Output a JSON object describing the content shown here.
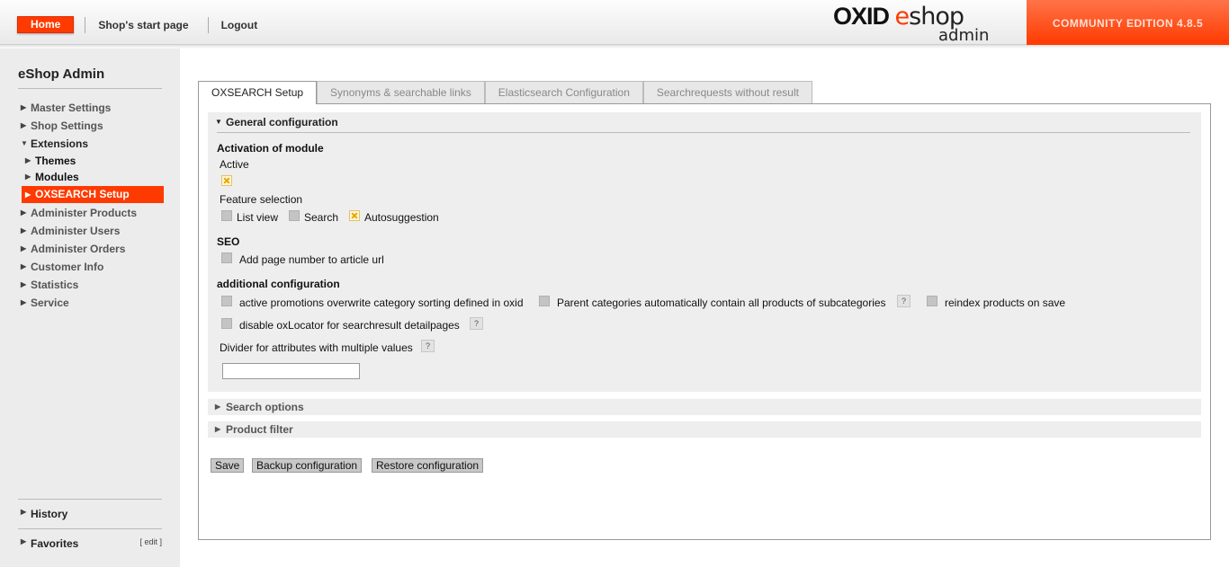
{
  "header": {
    "home_label": "Home",
    "start_page_label": "Shop's start page",
    "logout_label": "Logout",
    "logo_oxid": "OXID",
    "logo_e": "e",
    "logo_shop": "shop",
    "logo_admin": "admin",
    "edition": "COMMUNITY EDITION 4.8.5",
    "accent_color": "#ff3a00"
  },
  "sidebar": {
    "title": "eShop Admin",
    "items": [
      {
        "label": "Master Settings",
        "state": "collapsed"
      },
      {
        "label": "Shop Settings",
        "state": "collapsed"
      },
      {
        "label": "Extensions",
        "state": "open"
      },
      {
        "label": "Themes",
        "state": "sub"
      },
      {
        "label": "Modules",
        "state": "sub"
      },
      {
        "label": "OXSEARCH Setup",
        "state": "active"
      },
      {
        "label": "Administer Products",
        "state": "collapsed"
      },
      {
        "label": "Administer Users",
        "state": "collapsed"
      },
      {
        "label": "Administer Orders",
        "state": "collapsed"
      },
      {
        "label": "Customer Info",
        "state": "collapsed"
      },
      {
        "label": "Statistics",
        "state": "collapsed"
      },
      {
        "label": "Service",
        "state": "collapsed"
      }
    ],
    "history_label": "History",
    "favorites_label": "Favorites",
    "edit_label": "[ edit ]"
  },
  "tabs": [
    {
      "label": "OXSEARCH Setup",
      "active": true
    },
    {
      "label": "Synonyms & searchable links",
      "active": false
    },
    {
      "label": "Elasticsearch Configuration",
      "active": false
    },
    {
      "label": "Searchrequests without result",
      "active": false
    }
  ],
  "general": {
    "title": "General configuration",
    "activation_title": "Activation of module",
    "active_label": "Active",
    "active_checked": true,
    "feature_label": "Feature selection",
    "features": [
      {
        "label": "List view",
        "checked": false
      },
      {
        "label": "Search",
        "checked": false
      },
      {
        "label": "Autosuggestion",
        "checked": true
      }
    ],
    "seo_title": "SEO",
    "seo_option": {
      "label": "Add page number to article url",
      "checked": false
    },
    "additional_title": "additional configuration",
    "additional_options": [
      {
        "label": "active promotions overwrite category sorting defined in oxid",
        "checked": false
      },
      {
        "label": "Parent categories automatically contain all products of subcategories",
        "checked": false
      },
      {
        "label": "reindex products on save",
        "checked": false
      },
      {
        "label": "disable oxLocator for searchresult detailpages",
        "checked": false
      }
    ],
    "divider_label": "Divider for attributes with multiple values",
    "divider_value": "",
    "help_glyph": "?"
  },
  "search_options": {
    "title": "Search options"
  },
  "product_filter": {
    "title": "Product filter"
  },
  "actions": {
    "save": "Save",
    "backup": "Backup configuration",
    "restore": "Restore configuration"
  }
}
